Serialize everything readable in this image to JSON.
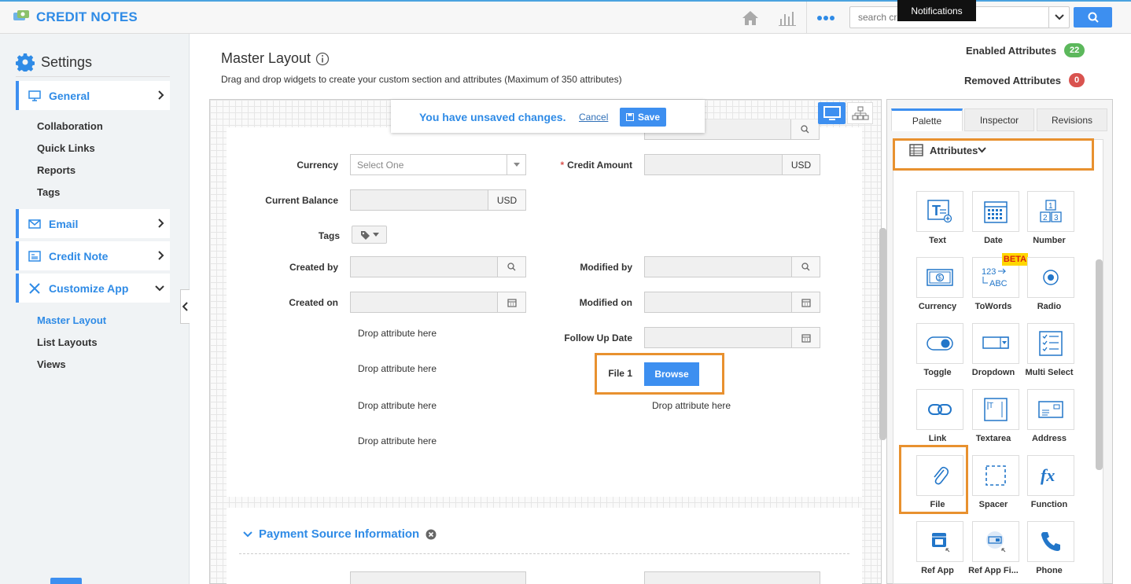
{
  "app": {
    "title": "CREDIT NOTES"
  },
  "header": {
    "search_placeholder": "search cr",
    "notifications_tooltip": "Notifications"
  },
  "sidebar": {
    "title": "Settings",
    "nav": [
      {
        "label": "General"
      },
      {
        "label": "Email"
      },
      {
        "label": "Credit Note"
      },
      {
        "label": "Customize App"
      }
    ],
    "general_sub": [
      "Collaboration",
      "Quick Links",
      "Reports",
      "Tags"
    ],
    "customize_sub": [
      "Master Layout",
      "List Layouts",
      "Views"
    ]
  },
  "page": {
    "title": "Master Layout",
    "description": "Drag and drop widgets to create your custom section and attributes (Maximum of 350 attributes)",
    "enabled_label": "Enabled Attributes",
    "enabled_count": "22",
    "removed_label": "Removed Attributes",
    "removed_count": "0"
  },
  "unsaved": {
    "message": "You have unsaved changes.",
    "cancel": "Cancel",
    "save": "Save"
  },
  "form": {
    "currency_label": "Currency",
    "currency_placeholder": "Select One",
    "credit_amount_label": "Credit Amount",
    "credit_amount_unit": "USD",
    "current_balance_label": "Current Balance",
    "current_balance_unit": "USD",
    "tags_label": "Tags",
    "created_by_label": "Created by",
    "modified_by_label": "Modified by",
    "created_on_label": "Created on",
    "modified_on_label": "Modified on",
    "follow_up_label": "Follow Up Date",
    "file1_label": "File 1",
    "browse": "Browse",
    "drop_text": "Drop attribute here"
  },
  "section2": {
    "title": "Payment Source Information"
  },
  "palette": {
    "tabs": [
      "Palette",
      "Inspector",
      "Revisions"
    ],
    "attributes_header": "Attributes",
    "beta": "BETA",
    "widgets": [
      "Text",
      "Date",
      "Number",
      "Currency",
      "ToWords",
      "Radio",
      "Toggle",
      "Dropdown",
      "Multi Select",
      "Link",
      "Textarea",
      "Address",
      "File",
      "Spacer",
      "Function",
      "Ref App",
      "Ref App Fi...",
      "Phone"
    ]
  },
  "colors": {
    "accent": "#3d8ff0",
    "highlight": "#e8912f",
    "success": "#5cb85c",
    "danger": "#d9534f"
  }
}
